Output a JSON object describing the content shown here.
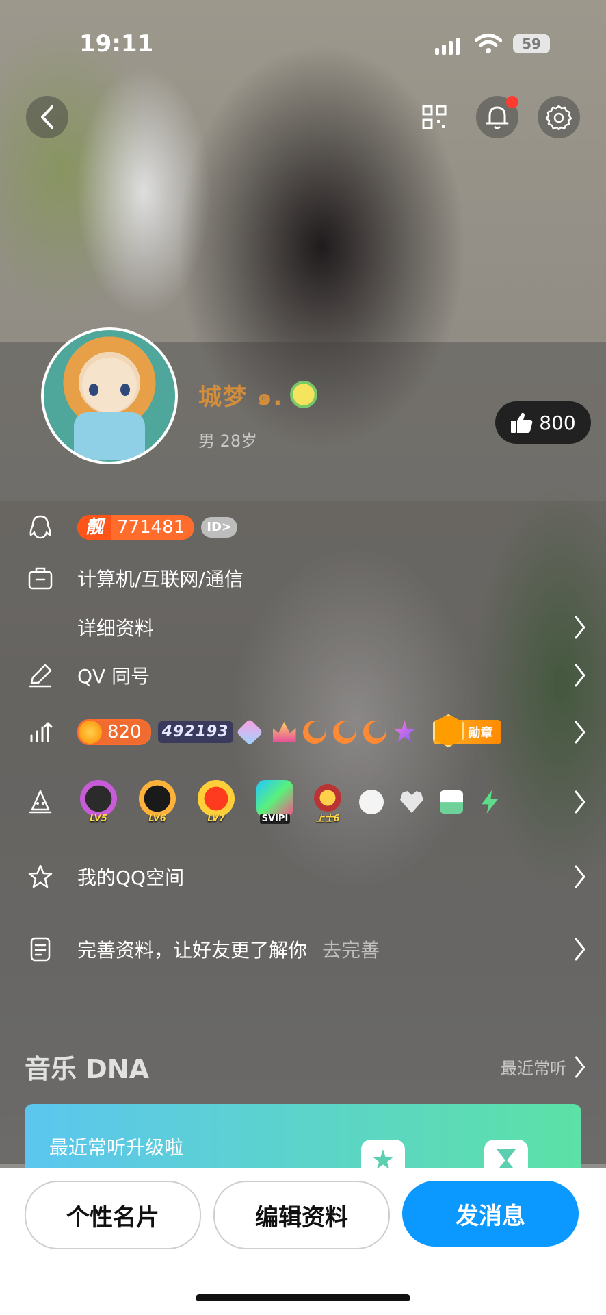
{
  "status_bar": {
    "time": "19:11",
    "battery": "59"
  },
  "profile": {
    "nickname": "城梦 ๑.",
    "gender_age": "男  28岁",
    "likes": "800"
  },
  "info_rows": {
    "qq_tag": "靓",
    "qq_number": "771481",
    "id_badge": "ID>",
    "occupation": "计算机/互联网/通信",
    "details": "详细资料",
    "qv": "QV 同号",
    "coin_level": "820",
    "score_badge": "492193",
    "medal": "勋章",
    "levels": [
      "LV5",
      "LV6",
      "LV7",
      "SVIPI",
      "上士6"
    ],
    "qzone": "我的QQ空间",
    "complete": "完善资料，让好友更了解你",
    "complete_action": "去完善"
  },
  "music": {
    "title": "音乐 DNA",
    "link": "最近常听",
    "card_title": "最近常听升级啦"
  },
  "actions": {
    "card": "个性名片",
    "edit": "编辑资料",
    "message": "发消息"
  },
  "colors": {
    "primary": "#0b99ff",
    "qq_orange": "#ff6c2b",
    "nickname": "#d48d3a"
  }
}
